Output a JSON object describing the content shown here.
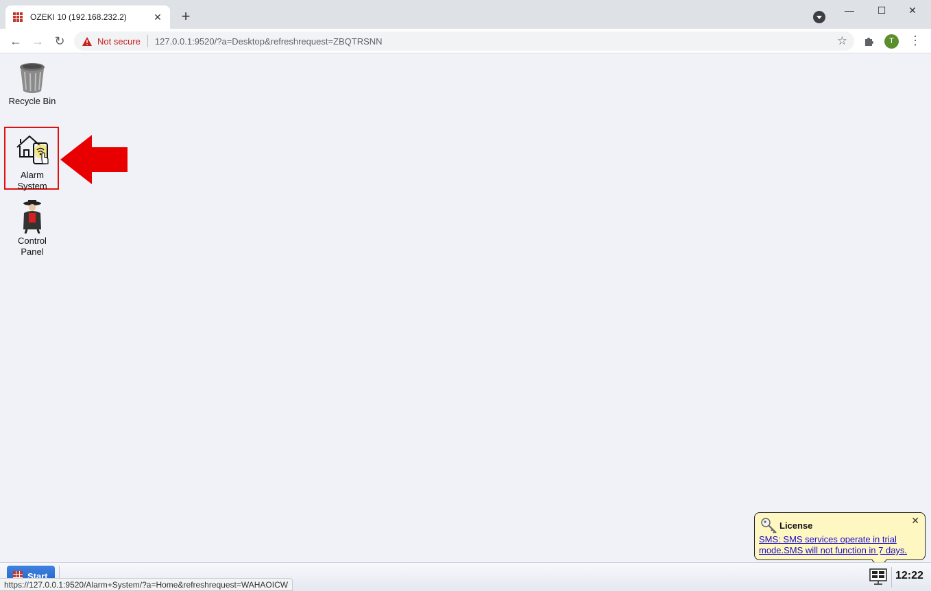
{
  "browser": {
    "tab_title": "OZEKI 10 (192.168.232.2)",
    "tab_close": "✕",
    "new_tab": "+",
    "window_controls": {
      "minimize": "—",
      "maximize": "☐",
      "close": "✕"
    },
    "security_label": "Not secure",
    "url": "127.0.0.1:9520/?a=Desktop&refreshrequest=ZBQTRSNN",
    "profile_initial": "T",
    "status_url": "https://127.0.0.1:9520/Alarm+System/?a=Home&refreshrequest=WAHAOICW"
  },
  "desktop": {
    "icons": [
      {
        "label": "Recycle Bin",
        "icon": "recycle-bin-icon"
      },
      {
        "label_line1": "Alarm",
        "label_line2": "System",
        "icon": "alarm-system-icon",
        "highlighted": true
      },
      {
        "label_line1": "Control",
        "label_line2": "Panel",
        "icon": "control-panel-icon"
      }
    ]
  },
  "notification": {
    "title": "License",
    "message": "SMS: SMS services operate in trial mode.SMS will not function in 7 days.",
    "close": "✕"
  },
  "taskbar": {
    "start_label": "Start",
    "clock": "12:22"
  },
  "colors": {
    "highlight_red": "#e01010",
    "desktop_bg": "#f0f2f7",
    "notify_bg": "#fff7c2",
    "start_blue": "#1d5fc4"
  }
}
